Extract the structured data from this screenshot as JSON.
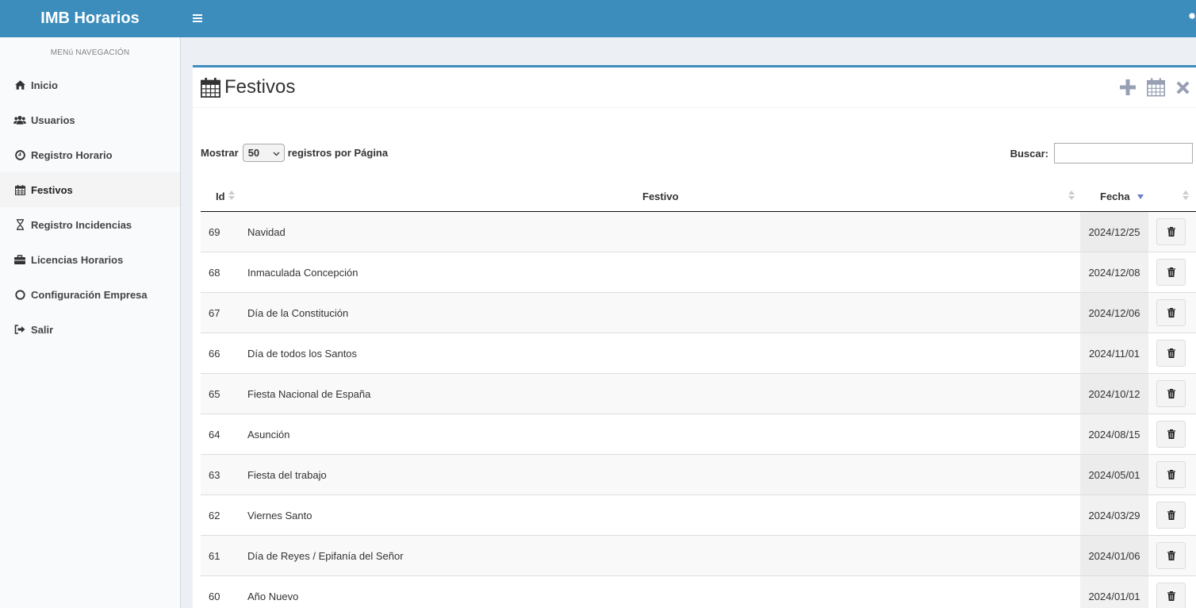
{
  "app": {
    "title": "IMB Horarios"
  },
  "header": {
    "menu_icon": "bars-icon",
    "settings_icon": "gear-icon"
  },
  "sidebar": {
    "header": "MENú NAVEGACIÓN",
    "items": [
      {
        "label": "Inicio",
        "icon": "home-icon"
      },
      {
        "label": "Usuarios",
        "icon": "users-icon"
      },
      {
        "label": "Registro Horario",
        "icon": "clock-icon"
      },
      {
        "label": "Festivos",
        "icon": "calendar-icon",
        "active": true
      },
      {
        "label": "Registro Incidencias",
        "icon": "hourglass-icon"
      },
      {
        "label": "Licencias Horarios",
        "icon": "briefcase-icon"
      },
      {
        "label": "Configuración Empresa",
        "icon": "circle-icon"
      },
      {
        "label": "Salir",
        "icon": "sign-out-icon"
      }
    ]
  },
  "page": {
    "title": "Festivos",
    "tools": [
      "plus-icon",
      "calendar-icon",
      "close-icon"
    ]
  },
  "controls": {
    "show_label": "Mostrar",
    "page_size": "50",
    "per_page_label": "registros por Página",
    "search_label": "Buscar:",
    "search_value": ""
  },
  "table": {
    "columns": [
      "Id",
      "Festivo",
      "Fecha",
      ""
    ],
    "sorted_column": "Fecha",
    "sort_direction": "desc",
    "rows": [
      {
        "id": "69",
        "festivo": "Navidad",
        "fecha": "2024/12/25"
      },
      {
        "id": "68",
        "festivo": "Inmaculada Concepción",
        "fecha": "2024/12/08"
      },
      {
        "id": "67",
        "festivo": "Día de la Constitución",
        "fecha": "2024/12/06"
      },
      {
        "id": "66",
        "festivo": "Día de todos los Santos",
        "fecha": "2024/11/01"
      },
      {
        "id": "65",
        "festivo": "Fiesta Nacional de España",
        "fecha": "2024/10/12"
      },
      {
        "id": "64",
        "festivo": "Asunción",
        "fecha": "2024/08/15"
      },
      {
        "id": "63",
        "festivo": "Fiesta del trabajo",
        "fecha": "2024/05/01"
      },
      {
        "id": "62",
        "festivo": "Viernes Santo",
        "fecha": "2024/03/29"
      },
      {
        "id": "61",
        "festivo": "Día de Reyes / Epifanía del Señor",
        "fecha": "2024/01/06"
      },
      {
        "id": "60",
        "festivo": "Año Nuevo",
        "fecha": "2024/01/01"
      }
    ]
  },
  "colors": {
    "header": "#3c8dbc",
    "sidebar_bg": "#f9fafc",
    "content_bg": "#ecf0f5",
    "tool_icons": "#97a0b3"
  }
}
